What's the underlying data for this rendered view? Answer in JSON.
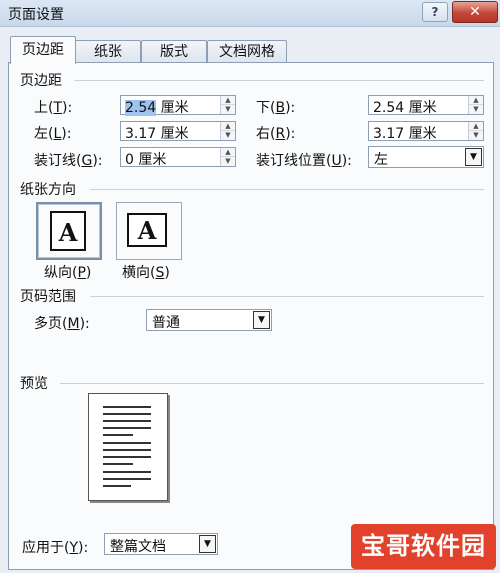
{
  "window": {
    "title": "页面设置",
    "help_glyph": "?",
    "close_glyph": "✕"
  },
  "tabs": [
    "页边距",
    "纸张",
    "版式",
    "文档网格"
  ],
  "margins": {
    "group_label": "页边距",
    "top": {
      "label": "上",
      "key": "T",
      "suffix": "):",
      "num": "2.54",
      "unit": "厘米"
    },
    "bottom": {
      "label": "下",
      "key": "B",
      "suffix": "):",
      "num": "2.54",
      "unit": "厘米"
    },
    "left": {
      "label": "左",
      "key": "L",
      "suffix": "):",
      "num": "3.17",
      "unit": "厘米"
    },
    "right": {
      "label": "右",
      "key": "R",
      "suffix": "):",
      "num": "3.17",
      "unit": "厘米"
    },
    "gutter": {
      "label": "装订线",
      "key": "G",
      "suffix": "):",
      "num": "0",
      "unit": "厘米"
    },
    "gutter_position": {
      "label": "装订线位置",
      "key": "U",
      "suffix": "):",
      "value": "左"
    }
  },
  "orientation": {
    "group_label": "纸张方向",
    "icon_letter": "A",
    "portrait": {
      "label": "纵向",
      "key": "P",
      "suffix": ")"
    },
    "landscape": {
      "label": "横向",
      "key": "S",
      "suffix": ")"
    }
  },
  "pages": {
    "group_label": "页码范围",
    "multiple": {
      "label": "多页",
      "key": "M",
      "suffix": "):",
      "value": "普通"
    }
  },
  "preview": {
    "group_label": "预览"
  },
  "apply_to": {
    "label": "应用于",
    "key": "Y",
    "suffix": "):",
    "value": "整篇文档"
  },
  "watermark": {
    "text": "宝哥软件园"
  },
  "colors": {
    "accent": "#9fc3ef",
    "watermark_bg": "#e2412c"
  }
}
